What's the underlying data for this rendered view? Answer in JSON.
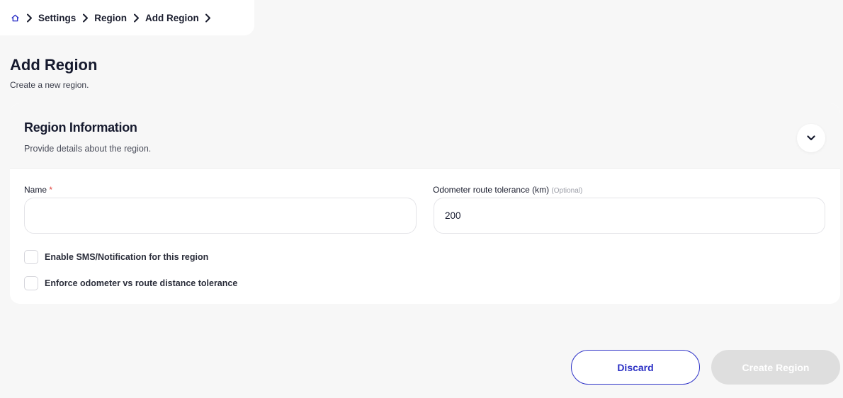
{
  "breadcrumb": {
    "home_icon": "home-icon",
    "items": [
      "Settings",
      "Region",
      "Add Region"
    ],
    "separator_icon": "chevron-right-icon"
  },
  "header": {
    "title": "Add Region",
    "subtitle": "Create a new region."
  },
  "card": {
    "title": "Region Information",
    "description": "Provide details about the region.",
    "collapse_icon": "chevron-down-icon",
    "fields": {
      "name": {
        "label": "Name",
        "required_mark": "*",
        "value": "",
        "placeholder": ""
      },
      "odometer": {
        "label": "Odometer route tolerance (km)",
        "optional_tag": "(Optional)",
        "value": "200"
      }
    },
    "checkboxes": [
      {
        "label": "Enable SMS/Notification for this region",
        "checked": false
      },
      {
        "label": "Enforce odometer vs route distance tolerance",
        "checked": false
      }
    ]
  },
  "actions": {
    "discard_label": "Discard",
    "create_label": "Create Region",
    "create_disabled": true
  },
  "colors": {
    "accent": "#2f33c8",
    "required": "#e0413a",
    "disabled_button": "#dedede",
    "background": "#f7f7f7"
  }
}
